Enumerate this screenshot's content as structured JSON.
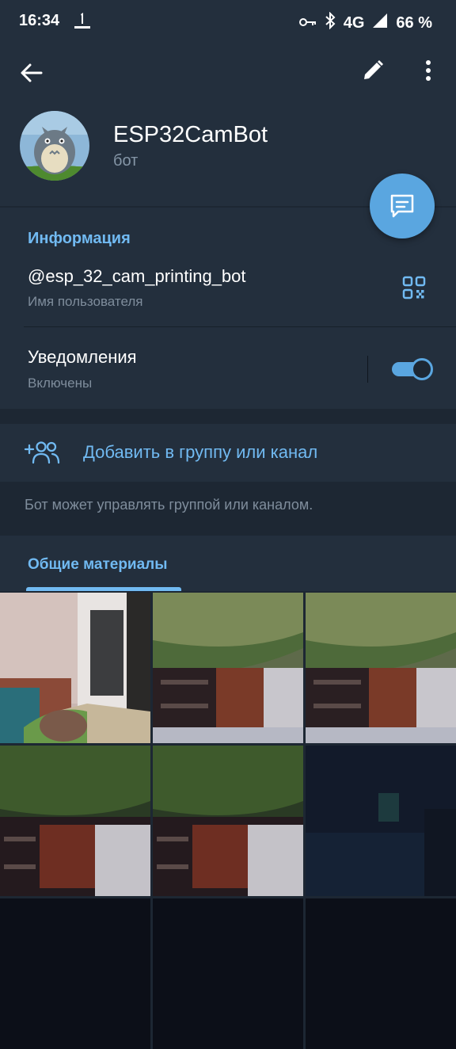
{
  "status_bar": {
    "time": "16:34",
    "network": "4G",
    "battery": "66 %"
  },
  "toolbar": {
    "back_icon": "arrow-left-icon",
    "edit_icon": "pencil-icon",
    "more_icon": "more-vertical-icon"
  },
  "profile": {
    "name": "ESP32CamBot",
    "subtitle": "бот"
  },
  "info": {
    "section_title": "Информация",
    "username": "@esp_32_cam_printing_bot",
    "username_label": "Имя пользователя",
    "notifications_title": "Уведомления",
    "notifications_state": "Включены",
    "notifications_on": true
  },
  "actions": {
    "add_to_group": "Добавить в группу или канал",
    "hint": "Бот может управлять группой или каналом."
  },
  "media": {
    "tab_label": "Общие материалы",
    "photos": [
      {
        "kind": "room-curtain"
      },
      {
        "kind": "ceiling-tilted"
      },
      {
        "kind": "ceiling-tilted"
      },
      {
        "kind": "ceiling-tilted-2"
      },
      {
        "kind": "ceiling-tilted-2"
      },
      {
        "kind": "dark-room"
      },
      {
        "kind": "black"
      },
      {
        "kind": "black"
      },
      {
        "kind": "black"
      }
    ]
  },
  "colors": {
    "accent": "#71baf2",
    "fab": "#5aa6e0",
    "background": "#1d2733",
    "panel": "#232f3d"
  }
}
